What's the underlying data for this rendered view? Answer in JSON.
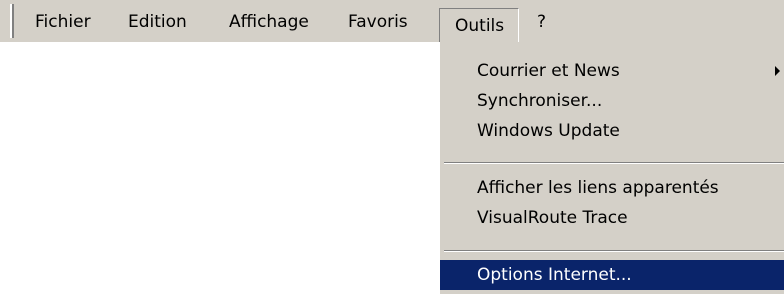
{
  "menubar": {
    "items": [
      {
        "label": "Fichier"
      },
      {
        "label": "Edition"
      },
      {
        "label": "Affichage"
      },
      {
        "label": "Favoris"
      },
      {
        "label": "Outils"
      },
      {
        "label": "?"
      }
    ]
  },
  "dropdown": {
    "items": [
      {
        "label": "Courrier et News",
        "submenu_icon": "triangle-right-icon"
      },
      {
        "label": "Synchroniser..."
      },
      {
        "label": "Windows Update"
      },
      {
        "label": "Afficher les liens apparentés"
      },
      {
        "label": "VisualRoute Trace"
      },
      {
        "label": "Options Internet..."
      }
    ],
    "selected_color": "#0a246a"
  }
}
